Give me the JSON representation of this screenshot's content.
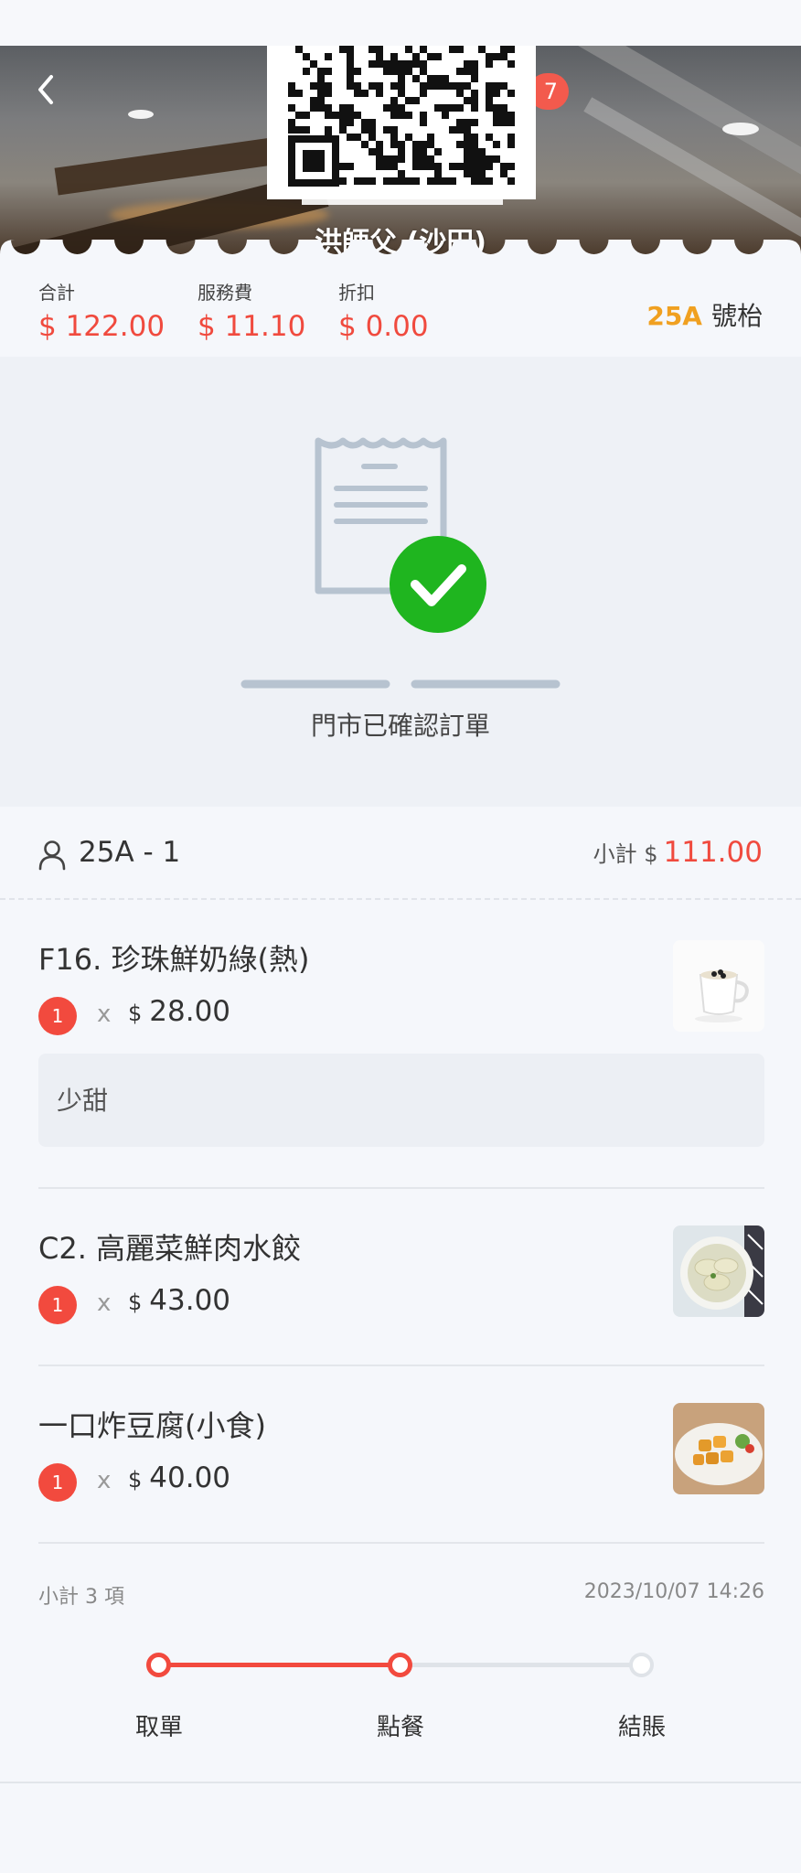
{
  "header": {
    "back_label": "back",
    "badge_count": "7",
    "store_name": "洪師父 (沙田)"
  },
  "summary": {
    "total_label": "合計",
    "total_value": "$ 122.00",
    "service_label": "服務費",
    "service_value": "$ 11.10",
    "discount_label": "折扣",
    "discount_value": "$ 0.00",
    "table_code": "25A",
    "table_suffix": "號枱"
  },
  "confirmation": {
    "message": "門市已確認訂單"
  },
  "guest": {
    "name": "25A - 1",
    "subtotal_label": "小計 $",
    "subtotal_value": "111.00"
  },
  "items": [
    {
      "name": "F16. 珍珠鮮奶綠(熱)",
      "qty": "1",
      "times": "x",
      "currency": "$",
      "price": "28.00",
      "note": "少甜",
      "thumb": "milk-tea-image"
    },
    {
      "name": "C2. 高麗菜鮮肉水餃",
      "qty": "1",
      "times": "x",
      "currency": "$",
      "price": "43.00",
      "thumb": "dumplings-image"
    },
    {
      "name": "一口炸豆腐(小食)",
      "qty": "1",
      "times": "x",
      "currency": "$",
      "price": "40.00",
      "thumb": "fried-tofu-image"
    }
  ],
  "footer": {
    "item_count": "小計 3 項",
    "timestamp": "2023/10/07 14:26"
  },
  "progress": {
    "steps": [
      "取單",
      "點餐",
      "結賬"
    ],
    "active_step": 2,
    "accent": "#f24a3e",
    "inactive": "#dfe3e8"
  },
  "colors": {
    "price_red": "#f04a3e",
    "table_orange": "#f0a020",
    "check_green": "#1fb51f"
  }
}
